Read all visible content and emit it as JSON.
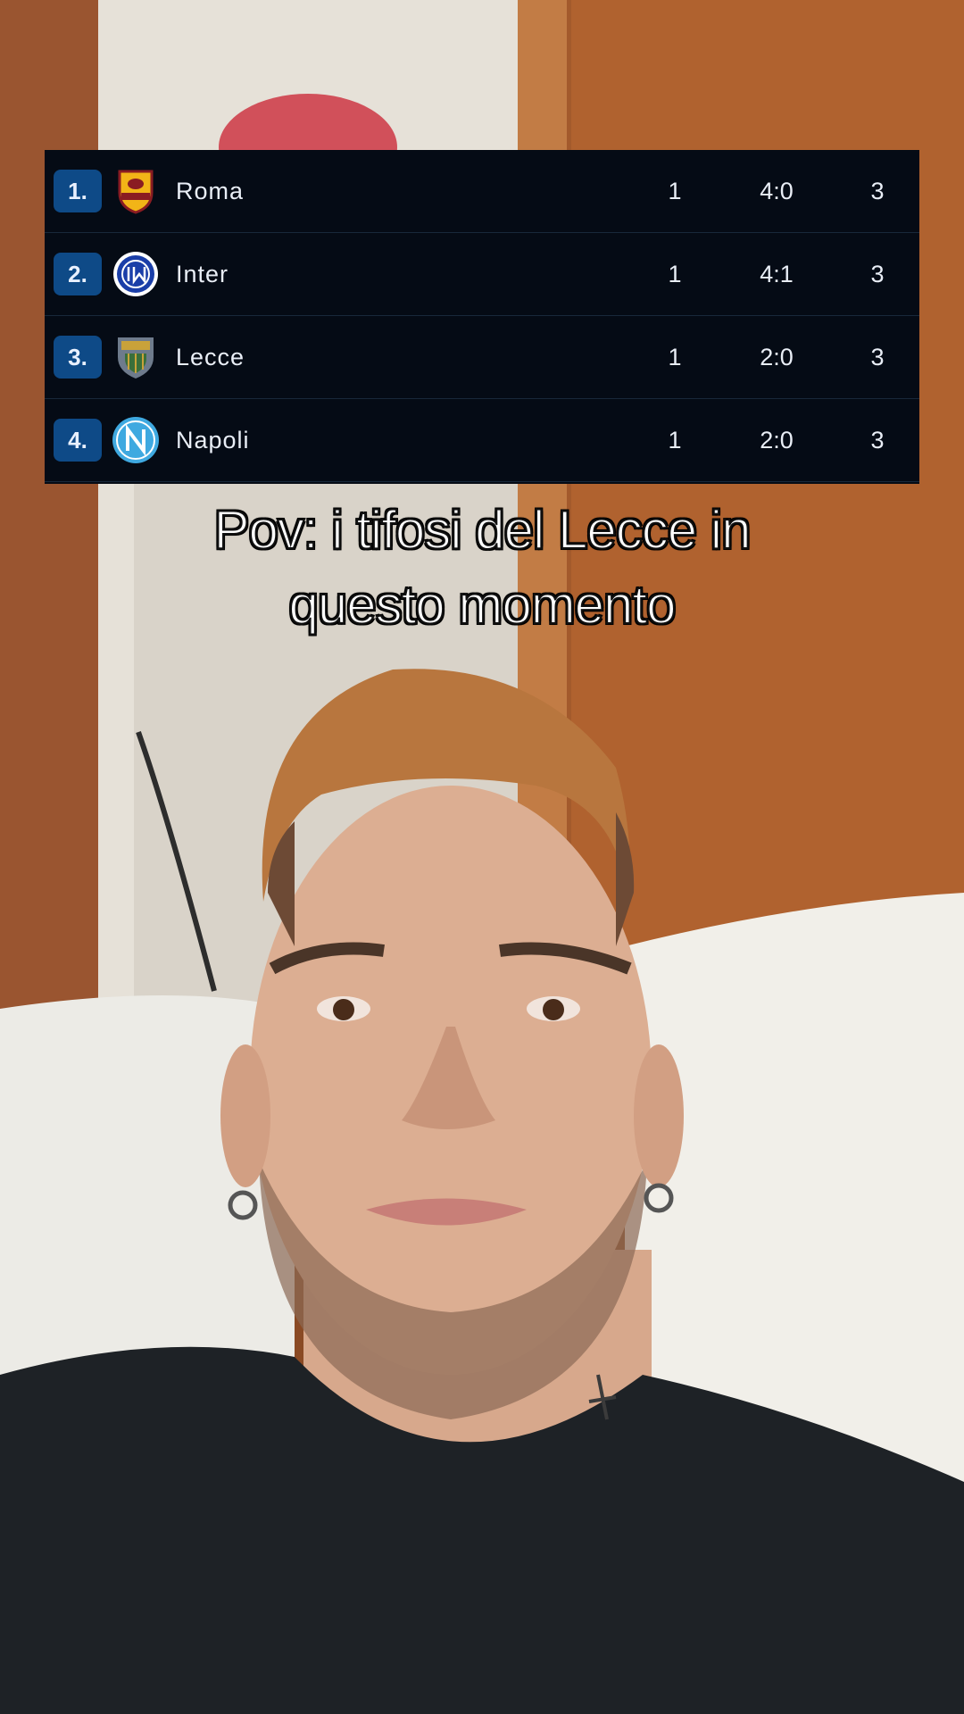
{
  "standings": [
    {
      "position": "1.",
      "team": "Roma",
      "crest_icon": "roma-crest-icon",
      "played": "1",
      "goals": "4:0",
      "points": "3"
    },
    {
      "position": "2.",
      "team": "Inter",
      "crest_icon": "inter-crest-icon",
      "played": "1",
      "goals": "4:1",
      "points": "3"
    },
    {
      "position": "3.",
      "team": "Lecce",
      "crest_icon": "lecce-crest-icon",
      "played": "1",
      "goals": "2:0",
      "points": "3"
    },
    {
      "position": "4.",
      "team": "Napoli",
      "crest_icon": "napoli-crest-icon",
      "played": "1",
      "goals": "2:0",
      "points": "3"
    }
  ],
  "caption": {
    "line1": "Pov: i tifosi del Lecce in",
    "line2": "questo momento"
  },
  "colors": {
    "table_background": "#050b15",
    "position_badge": "#0e4a87",
    "table_text": "#e9eef6"
  }
}
